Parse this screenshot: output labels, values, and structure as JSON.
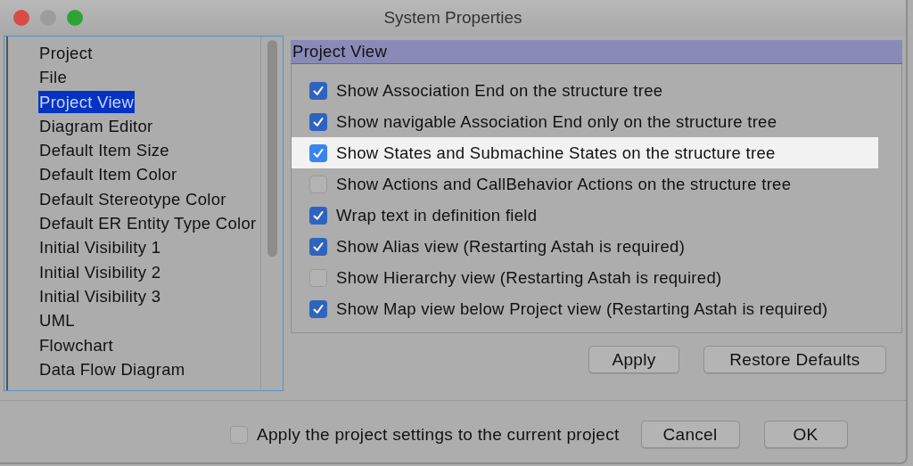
{
  "window": {
    "title": "System Properties"
  },
  "sidebar": {
    "items": [
      {
        "label": "Project",
        "selected": false
      },
      {
        "label": "File",
        "selected": false
      },
      {
        "label": "Project View",
        "selected": true
      },
      {
        "label": "Diagram Editor",
        "selected": false
      },
      {
        "label": "Default Item Size",
        "selected": false
      },
      {
        "label": "Default Item Color",
        "selected": false
      },
      {
        "label": "Default Stereotype Color",
        "selected": false
      },
      {
        "label": "Default ER Entity Type Color",
        "selected": false
      },
      {
        "label": "Initial Visibility 1",
        "selected": false
      },
      {
        "label": "Initial Visibility 2",
        "selected": false
      },
      {
        "label": "Initial Visibility 3",
        "selected": false
      },
      {
        "label": "UML",
        "selected": false
      },
      {
        "label": "Flowchart",
        "selected": false
      },
      {
        "label": "Data Flow Diagram",
        "selected": false
      }
    ]
  },
  "panel": {
    "title": "Project View",
    "options": [
      {
        "label": "Show Association End on the structure tree",
        "checked": true,
        "focused": false
      },
      {
        "label": "Show navigable Association End only on the structure tree",
        "checked": true,
        "focused": false
      },
      {
        "label": "Show States and Submachine States on the structure tree",
        "checked": true,
        "focused": true
      },
      {
        "label": "Show Actions and CallBehavior Actions on the structure tree",
        "checked": false,
        "focused": false
      },
      {
        "label": "Wrap text in definition field",
        "checked": true,
        "focused": false
      },
      {
        "label": "Show Alias view (Restarting Astah is required)",
        "checked": true,
        "focused": false
      },
      {
        "label": "Show Hierarchy view (Restarting Astah is required)",
        "checked": false,
        "focused": false
      },
      {
        "label": "Show Map view below Project view (Restarting Astah is required)",
        "checked": true,
        "focused": false
      }
    ],
    "buttons": [
      "Apply",
      "Restore Defaults"
    ]
  },
  "footer": {
    "apply_to_current": {
      "label": "Apply the project settings to the current project",
      "checked": false
    },
    "buttons": [
      "Cancel",
      "OK"
    ]
  }
}
